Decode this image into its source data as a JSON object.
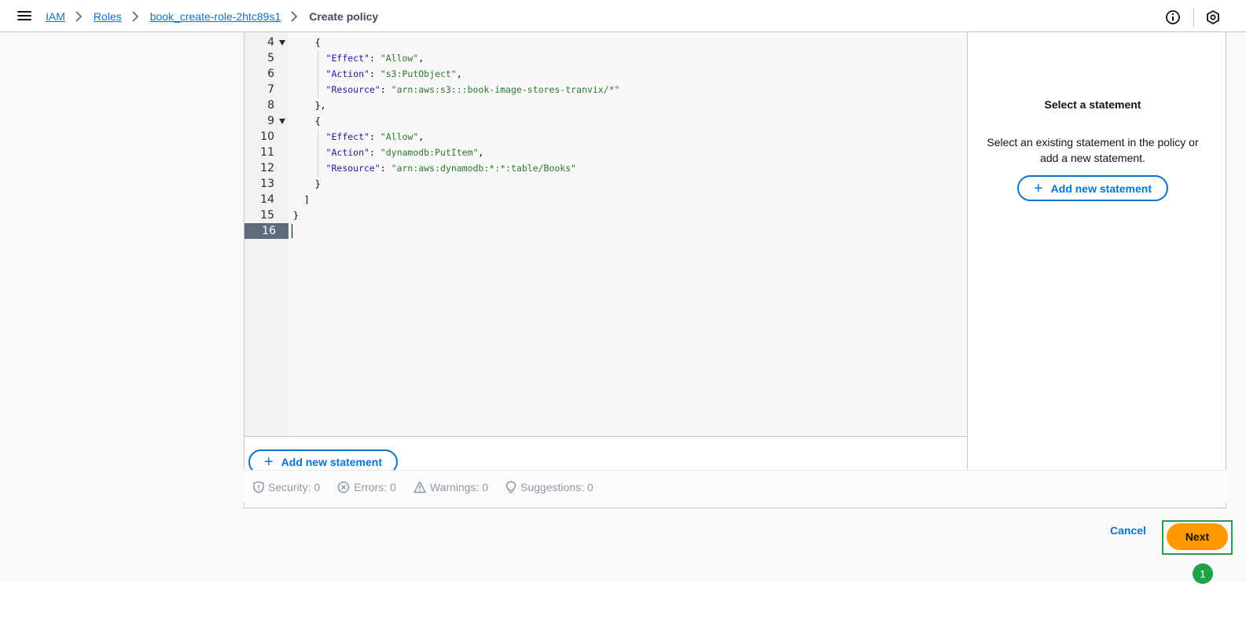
{
  "breadcrumb": {
    "items": [
      "IAM",
      "Roles",
      "book_create-role-2htc89s1"
    ],
    "current": "Create policy"
  },
  "editor": {
    "lines": [
      {
        "num": "4",
        "fold": true,
        "text": "    {"
      },
      {
        "num": "5",
        "fold": false,
        "key": "\"Effect\"",
        "value": "\"Allow\"",
        "suffix": ","
      },
      {
        "num": "6",
        "fold": false,
        "key": "\"Action\"",
        "value": "\"s3:PutObject\"",
        "suffix": ","
      },
      {
        "num": "7",
        "fold": false,
        "key": "\"Resource\"",
        "value": "\"arn:aws:s3:::book-image-stores-tranvix/*\"",
        "suffix": ""
      },
      {
        "num": "8",
        "fold": false,
        "text": "    },"
      },
      {
        "num": "9",
        "fold": true,
        "text": "    {"
      },
      {
        "num": "10",
        "fold": false,
        "key": "\"Effect\"",
        "value": "\"Allow\"",
        "suffix": ","
      },
      {
        "num": "11",
        "fold": false,
        "key": "\"Action\"",
        "value": "\"dynamodb:PutItem\"",
        "suffix": ","
      },
      {
        "num": "12",
        "fold": false,
        "key": "\"Resource\"",
        "value": "\"arn:aws:dynamodb:*:*:table/Books\"",
        "suffix": ""
      },
      {
        "num": "13",
        "fold": false,
        "text": "    }"
      },
      {
        "num": "14",
        "fold": false,
        "text": "  ]"
      },
      {
        "num": "15",
        "fold": false,
        "text": "}"
      },
      {
        "num": "16",
        "fold": false,
        "text": "",
        "active": true
      }
    ],
    "add_statement_label": "Add new statement"
  },
  "side_panel": {
    "title": "Select a statement",
    "description": "Select an existing statement in the policy or add a new statement.",
    "add_statement_label": "Add new statement"
  },
  "status": {
    "security": "Security: 0",
    "errors": "Errors: 0",
    "warnings": "Warnings: 0",
    "suggestions": "Suggestions: 0"
  },
  "actions": {
    "cancel": "Cancel",
    "next": "Next"
  },
  "annotation": {
    "badge": "1"
  },
  "colors": {
    "link": "#0972d3",
    "primary_button": "#ff9900",
    "highlight": "#1ea446"
  },
  "icons": [
    "menu-icon",
    "chevron-right-icon",
    "info-icon",
    "settings-hex-icon",
    "plus-icon",
    "shield-icon",
    "error-circle-icon",
    "warning-triangle-icon",
    "lightbulb-icon"
  ]
}
